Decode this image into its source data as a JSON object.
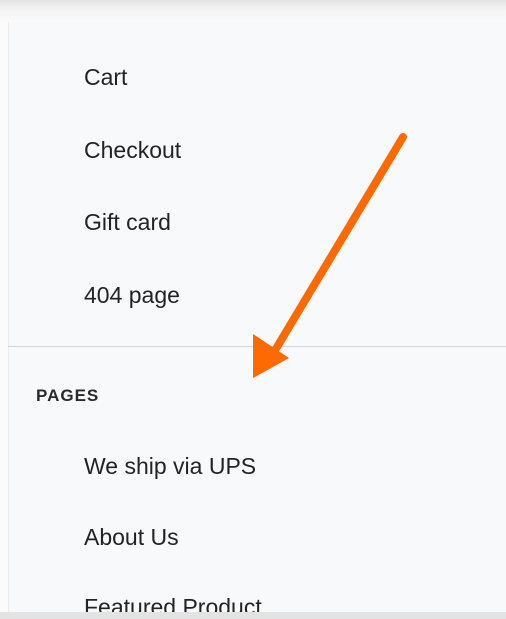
{
  "menu": {
    "top_items": [
      {
        "label": "Cart"
      },
      {
        "label": "Checkout"
      },
      {
        "label": "Gift card"
      },
      {
        "label": "404 page"
      }
    ],
    "pages_section": {
      "heading": "PAGES",
      "items": [
        {
          "label": "We ship via UPS"
        },
        {
          "label": "About Us"
        },
        {
          "label": "Featured Product"
        }
      ]
    }
  },
  "annotation": {
    "arrow_color": "#ff6a00"
  },
  "colors": {
    "text": "#232323",
    "panel_bg": "#f8f9fa",
    "divider": "#d4d6d8"
  }
}
